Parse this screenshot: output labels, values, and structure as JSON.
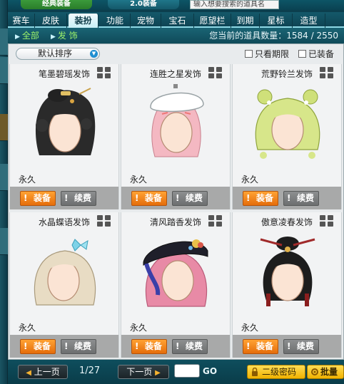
{
  "top": {
    "tab_classic": "经典装备",
    "tab_v2": "2.0装备",
    "search_placeholder": "输入想要搜索的道具名"
  },
  "tabs": [
    {
      "label": "赛车",
      "active": false
    },
    {
      "label": "皮肤",
      "active": false
    },
    {
      "label": "装扮",
      "active": true
    },
    {
      "label": "功能",
      "active": false
    },
    {
      "label": "宠物",
      "active": false
    },
    {
      "label": "宝石",
      "active": false
    },
    {
      "label": "愿望栏",
      "active": false
    },
    {
      "label": "到期",
      "active": false
    },
    {
      "label": "星标",
      "active": false
    },
    {
      "label": "造型",
      "active": false
    }
  ],
  "subbar": {
    "all_label": "全部",
    "accessory_label": "发 饰",
    "count_text": "您当前的道具数量：1584 / 2550"
  },
  "filters": {
    "sort_value": "默认排序",
    "expiring_label": "只看期限",
    "equipped_label": "已装备"
  },
  "items": [
    {
      "name": "笔墨碧瑶发饰",
      "duration": "永久",
      "equip_label": "装备",
      "renew_label": "续费",
      "hair": "#2a2a2a"
    },
    {
      "name": "连胜之星发饰",
      "duration": "永久",
      "equip_label": "装备",
      "renew_label": "续费",
      "hair": "#f4b8c2"
    },
    {
      "name": "荒野铃兰发饰",
      "duration": "永久",
      "equip_label": "装备",
      "renew_label": "续费",
      "hair": "#cfe07a"
    },
    {
      "name": "水晶蝶语发饰",
      "duration": "永久",
      "equip_label": "装备",
      "renew_label": "续费",
      "hair": "#e8dcc4"
    },
    {
      "name": "清风踏香发饰",
      "duration": "永久",
      "equip_label": "装备",
      "renew_label": "续费",
      "hair": "#e88aa6"
    },
    {
      "name": "傲意凌春发饰",
      "duration": "永久",
      "equip_label": "装备",
      "renew_label": "续费",
      "hair": "#1d1d1d"
    }
  ],
  "pagination": {
    "prev_label": "上一页",
    "next_label": "下一页",
    "page_text": "1/27",
    "go_label": "GO"
  },
  "actions": {
    "password_label": "二级密码",
    "batch_label": "批量"
  },
  "colors": {
    "equip_orange": "#f58a1f",
    "renew_gray": "#7d7f80",
    "accent_teal": "#0e4e5d",
    "sub_green": "#9cf26a",
    "gold": "#f1b200"
  }
}
